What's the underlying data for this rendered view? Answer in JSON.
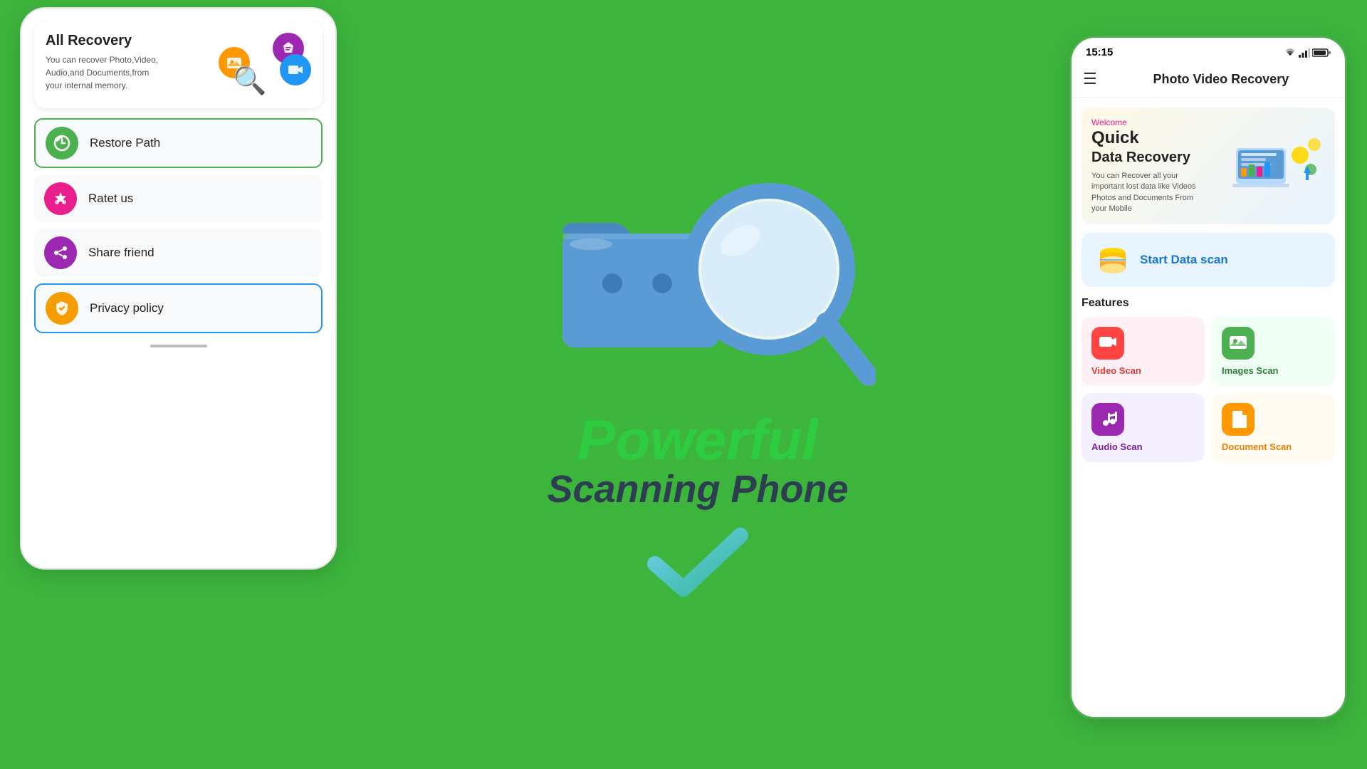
{
  "left_phone": {
    "all_recovery": {
      "title": "All Recovery",
      "description": "You can recover Photo,Video,\nAudio,and Documents,from\nyour internal memory."
    },
    "menu_items": [
      {
        "id": "restore-path",
        "label": "Restore Path",
        "icon_color": "green",
        "border": "green-border",
        "icon": "🔄"
      },
      {
        "id": "rate-us",
        "label": "Ratet us",
        "icon_color": "pink",
        "border": "",
        "icon": "⭐"
      },
      {
        "id": "share-friend",
        "label": "Share friend",
        "icon_color": "purple",
        "border": "",
        "icon": "↗"
      },
      {
        "id": "privacy-policy",
        "label": "Privacy policy",
        "icon_color": "gold",
        "border": "blue-border",
        "icon": "🛡"
      }
    ]
  },
  "center": {
    "powerful": "Powerful",
    "scanning": "Scanning Phone"
  },
  "right_phone": {
    "status_time": "15:15",
    "header_title": "Photo Video Recovery",
    "welcome_label": "Welcome",
    "quick_title": "Quick",
    "data_recovery": "Data  Recovery",
    "welcome_desc": "You can Recover all your important lost data like Videos Photos and Documents From your Mobile",
    "start_scan_label": "Start Data scan",
    "features_title": "Features",
    "features": [
      {
        "id": "video-scan",
        "label": "Video Scan",
        "color_class": "pink-bg",
        "icon_class": "red-icon",
        "text_class": "red-text",
        "icon": "▶"
      },
      {
        "id": "images-scan",
        "label": "Images Scan",
        "color_class": "green-bg",
        "icon_class": "green-icon",
        "text_class": "green-text",
        "icon": "🖼"
      },
      {
        "id": "audio-scan",
        "label": "Audio Scan",
        "color_class": "purple-bg",
        "icon_class": "purple-icon",
        "text_class": "purple-text",
        "icon": "🎵"
      },
      {
        "id": "document-scan",
        "label": "Document Scan",
        "color_class": "yellow-bg",
        "icon_class": "orange-icon",
        "text_class": "orange-text",
        "icon": "📄"
      }
    ]
  }
}
